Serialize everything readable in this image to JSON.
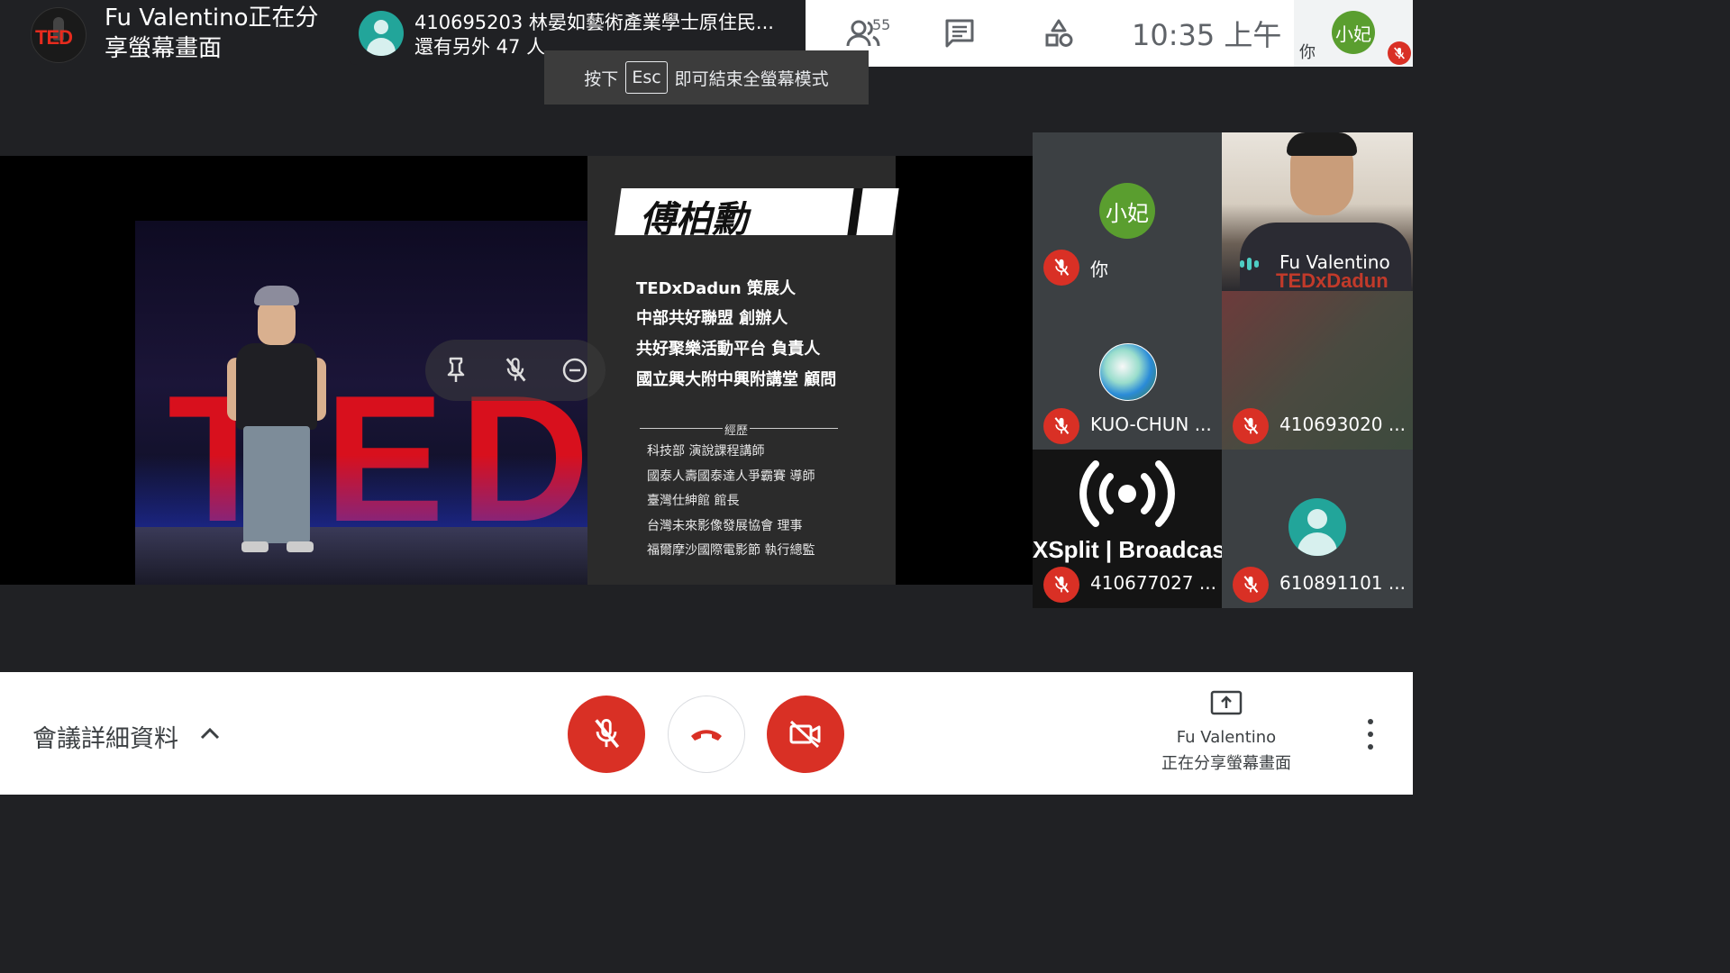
{
  "header": {
    "presenter_label": "Fu Valentino正在分享螢幕畫面",
    "participant_line1": "410695203 林晏如藝術產業學士原住民...",
    "participant_line2": "還有另外 47 人",
    "people_count": "55",
    "clock": "10:35 上午",
    "self_avatar_text": "小妃",
    "self_label": "你"
  },
  "esc_toast": {
    "prefix": "按下",
    "key": "Esc",
    "suffix": "即可結束全螢幕模式"
  },
  "slide": {
    "name": "傅柏勳",
    "roles": [
      "TEDxDadun 策展人",
      "中部共好聯盟 創辦人",
      "共好聚樂活動平台 負責人",
      "國立興大附中興附講堂 顧問"
    ],
    "experience_title": "經歷",
    "experience": [
      "科技部 演說課程講師",
      "國泰人壽國泰達人爭霸賽 導師",
      "臺灣仕紳館 館長",
      "台灣未來影像發展協會 理事",
      "福爾摩沙國際電影節 執行總監"
    ]
  },
  "tiles": [
    {
      "name": "你",
      "avatar_text": "小妃"
    },
    {
      "name": "Fu Valentino",
      "shirt_text": "TEDxDadun"
    },
    {
      "name": "KUO-CHUN ..."
    },
    {
      "name": "410693020 ..."
    },
    {
      "name": "410677027 ...",
      "logo_text": "XSplit | Broadcaster"
    },
    {
      "name": "610891101 ..."
    }
  ],
  "bottom": {
    "details_label": "會議詳細資料",
    "presenter_name": "Fu Valentino",
    "presenter_status": "正在分享螢幕畫面"
  },
  "colors": {
    "danger": "#d93025",
    "tile_bg": "#3c4043",
    "avatar_green": "#5a9e2f",
    "avatar_teal": "#22a59a"
  }
}
